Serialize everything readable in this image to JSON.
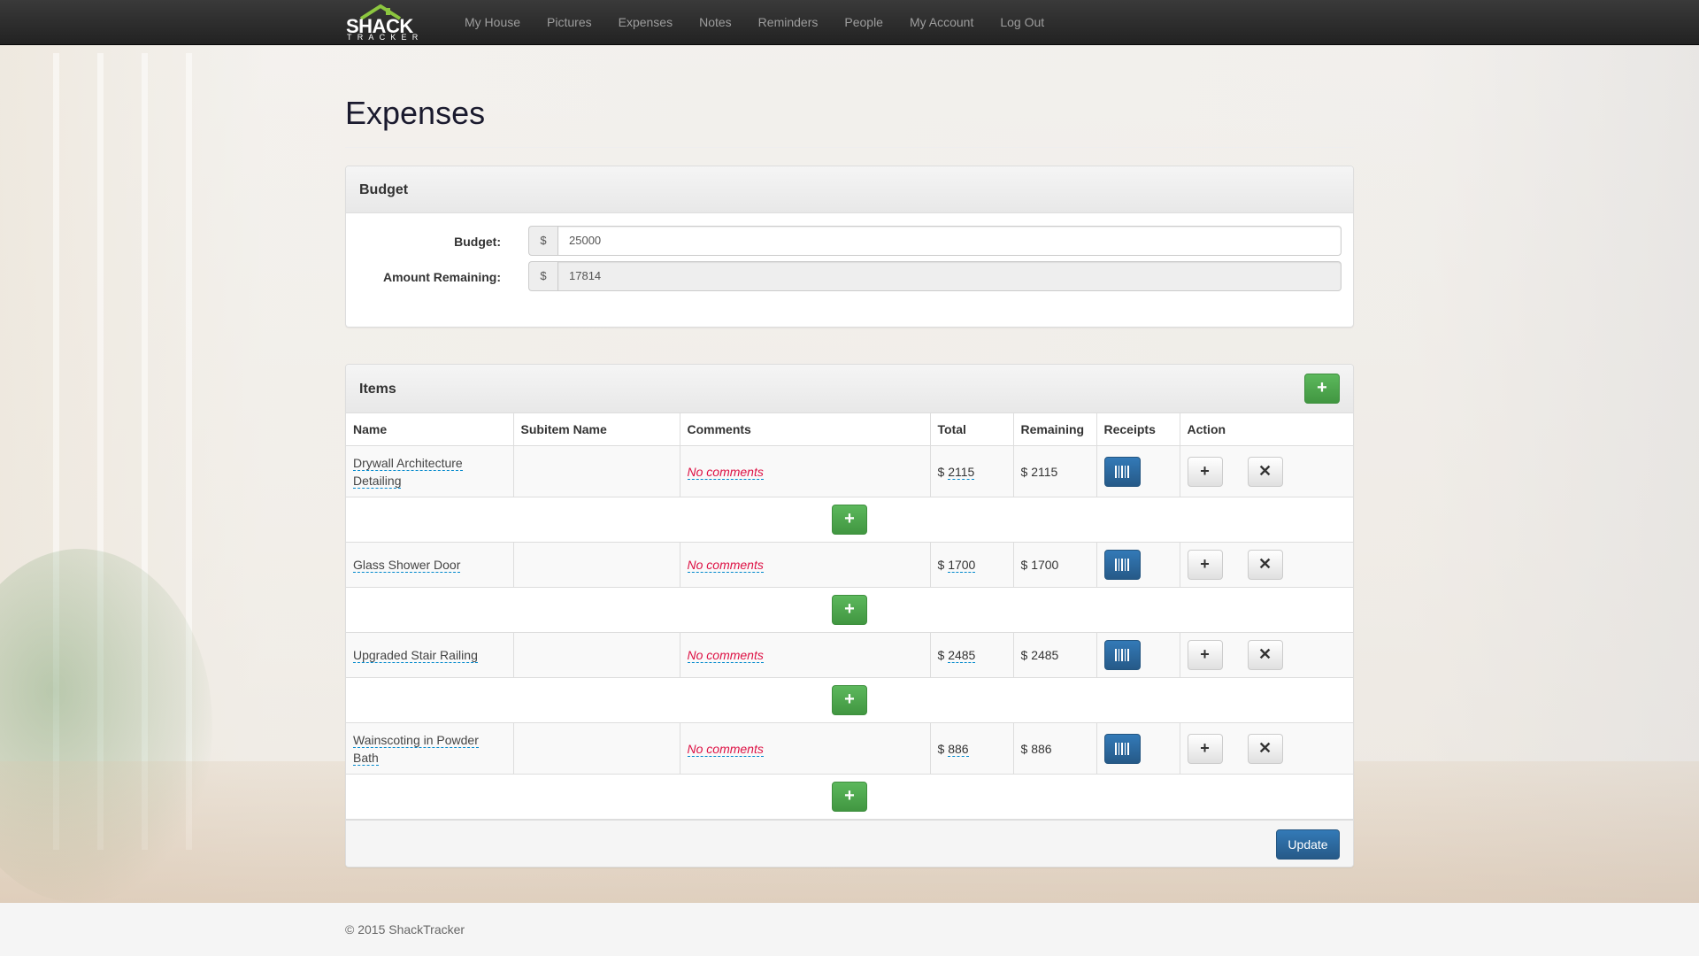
{
  "nav": {
    "brand_top": "SHACK",
    "brand_bottom": "TRACKER",
    "items": [
      "My House",
      "Pictures",
      "Expenses",
      "Notes",
      "Reminders",
      "People",
      "My Account",
      "Log Out"
    ]
  },
  "page": {
    "title": "Expenses"
  },
  "budget": {
    "panel_title": "Budget",
    "budget_label": "Budget:",
    "budget_value": "25000",
    "remaining_label": "Amount Remaining:",
    "remaining_value": "17814",
    "currency": "$"
  },
  "items": {
    "panel_title": "Items",
    "add_icon": "plus-icon",
    "columns": [
      "Name",
      "Subitem Name",
      "Comments",
      "Total",
      "Remaining",
      "Receipts",
      "Action"
    ],
    "rows": [
      {
        "name": "Drywall Architecture Detailing",
        "subitem": "",
        "comment": "No comments",
        "total": "2115",
        "remaining": "2115"
      },
      {
        "name": "Glass Shower Door",
        "subitem": "",
        "comment": "No comments",
        "total": "1700",
        "remaining": "1700"
      },
      {
        "name": "Upgraded Stair Railing",
        "subitem": "",
        "comment": "No comments",
        "total": "2485",
        "remaining": "2485"
      },
      {
        "name": "Wainscoting in Powder Bath",
        "subitem": "",
        "comment": "No comments",
        "total": "886",
        "remaining": "886"
      }
    ],
    "currency": "$",
    "update_label": "Update"
  },
  "footer": {
    "text": "© 2015 ShackTracker"
  },
  "colors": {
    "success": "#5cb85c",
    "primary": "#337ab7",
    "navbar": "#222222",
    "comment": "#dd1144"
  }
}
